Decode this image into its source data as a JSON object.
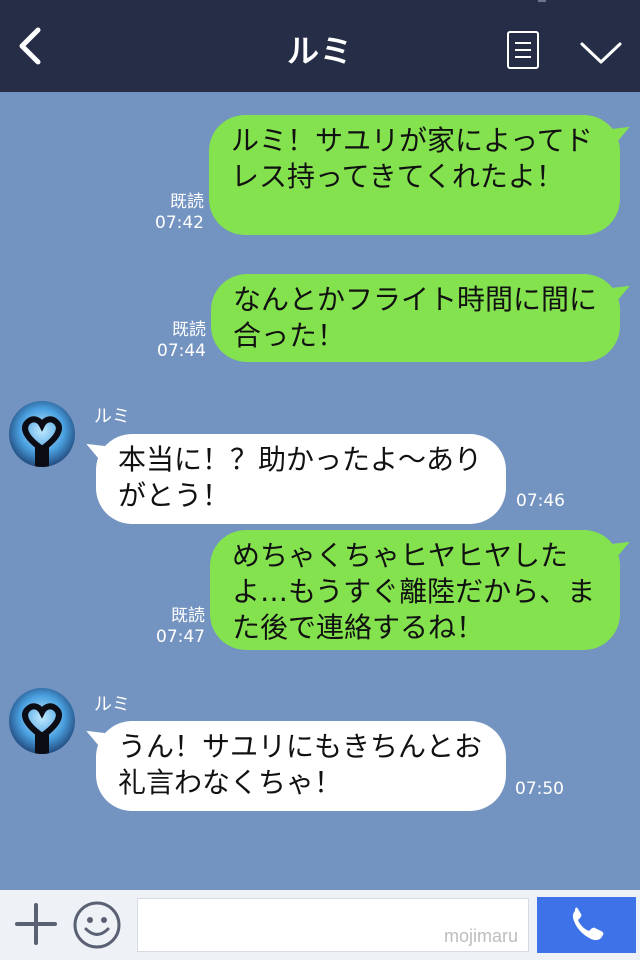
{
  "header": {
    "title": "ルミ",
    "back_icon": "chevron-left-icon",
    "menu_icon": "notes-icon",
    "more_icon": "chevron-down-icon"
  },
  "messages": [
    {
      "direction": "out",
      "text": "ルミ！サユリが家によってドレス持ってきてくれたよ！",
      "read": "既読",
      "time": "07:42"
    },
    {
      "direction": "out",
      "text": "なんとかフライト時間に間に合った！",
      "read": "既読",
      "time": "07:44"
    },
    {
      "direction": "in",
      "sender": "ルミ",
      "text": "本当に！？助かったよ〜ありがとう！",
      "time": "07:46"
    },
    {
      "direction": "out",
      "text": "めちゃくちゃヒヤヒヤしたよ…もうすぐ離陸だから、また後で連絡するね！",
      "read": "既読",
      "time": "07:47"
    },
    {
      "direction": "in",
      "sender": "ルミ",
      "text": "うん！サユリにもきちんとお礼言わなくちゃ！",
      "time": "07:50"
    }
  ],
  "footer": {
    "plus_icon": "plus-icon",
    "emoji_icon": "smiley-icon",
    "input_value": "",
    "watermark": "mojimaru",
    "call_icon": "phone-icon"
  },
  "colors": {
    "header_bg": "#252e46",
    "chat_bg": "#7393c0",
    "outgoing_bubble": "#84e24f",
    "incoming_bubble": "#ffffff",
    "call_button": "#3d72e8"
  }
}
